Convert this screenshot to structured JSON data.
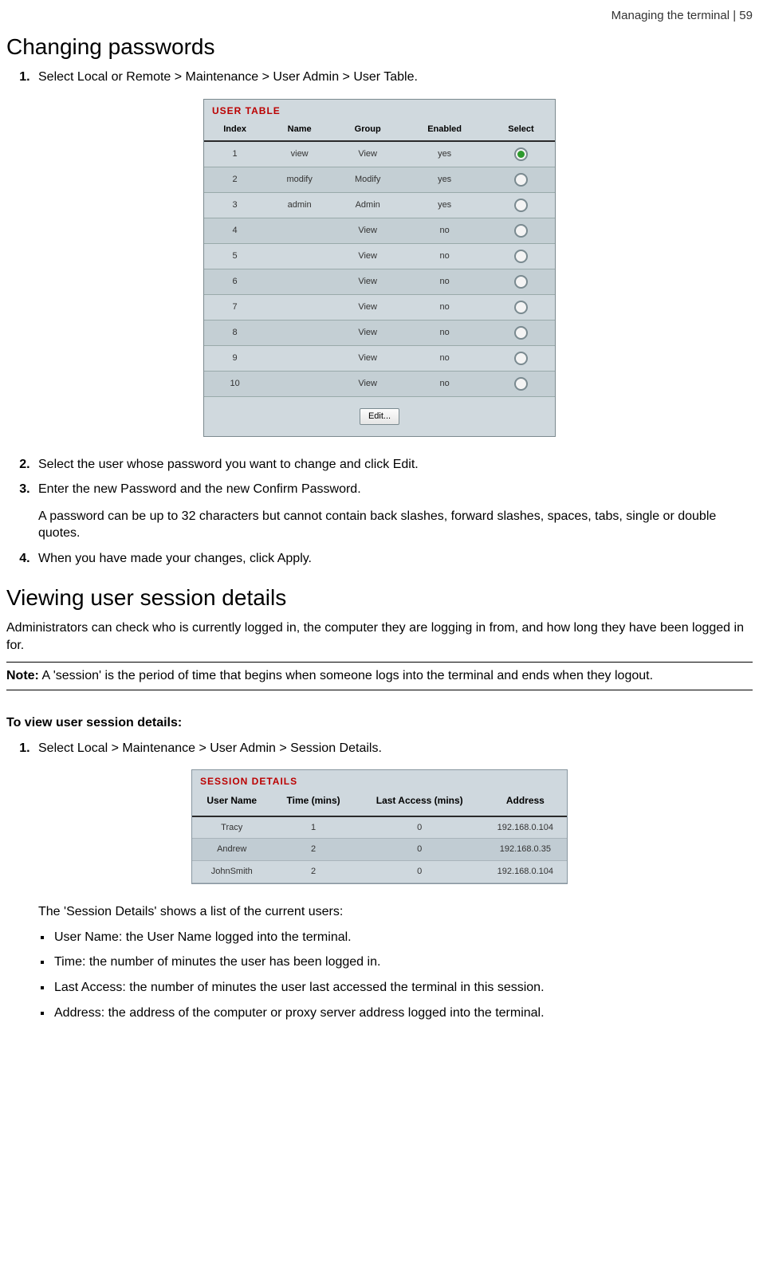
{
  "header": {
    "right": "Managing the terminal  |  59"
  },
  "h1": "Changing passwords",
  "step1": "Select Local or Remote > Maintenance > User Admin > User Table.",
  "userTable": {
    "title": "USER TABLE",
    "cols": {
      "c0": "Index",
      "c1": "Name",
      "c2": "Group",
      "c3": "Enabled",
      "c4": "Select"
    },
    "rows": [
      {
        "idx": "1",
        "name": "view",
        "group": "View",
        "enabled": "yes",
        "selected": true
      },
      {
        "idx": "2",
        "name": "modify",
        "group": "Modify",
        "enabled": "yes",
        "selected": false
      },
      {
        "idx": "3",
        "name": "admin",
        "group": "Admin",
        "enabled": "yes",
        "selected": false
      },
      {
        "idx": "4",
        "name": "",
        "group": "View",
        "enabled": "no",
        "selected": false
      },
      {
        "idx": "5",
        "name": "",
        "group": "View",
        "enabled": "no",
        "selected": false
      },
      {
        "idx": "6",
        "name": "",
        "group": "View",
        "enabled": "no",
        "selected": false
      },
      {
        "idx": "7",
        "name": "",
        "group": "View",
        "enabled": "no",
        "selected": false
      },
      {
        "idx": "8",
        "name": "",
        "group": "View",
        "enabled": "no",
        "selected": false
      },
      {
        "idx": "9",
        "name": "",
        "group": "View",
        "enabled": "no",
        "selected": false
      },
      {
        "idx": "10",
        "name": "",
        "group": "View",
        "enabled": "no",
        "selected": false
      }
    ],
    "editBtn": "Edit..."
  },
  "step2": "Select the user whose password you want to change and click Edit.",
  "step3": "Enter the new Password and the new Confirm Password.",
  "step3_para": "A password can be up to 32 characters but cannot contain back slashes, forward slashes, spaces, tabs, single or double quotes.",
  "step4": "When you have made your changes, click Apply.",
  "h2": "Viewing user session details",
  "intro": "Administrators can check who is currently logged in, the computer they are logging in from, and how long they have been logged in for.",
  "noteLabel": "Note:",
  "noteText": " A 'session' is the period of time that begins when someone logs into the terminal and ends when they logout.",
  "subhead": "To view user session details:",
  "sess_step1": "Select Local > Maintenance > User Admin > Session Details.",
  "sessTable": {
    "title": "SESSION DETAILS",
    "cols": {
      "c0": "User Name",
      "c1": "Time (mins)",
      "c2": "Last Access (mins)",
      "c3": "Address"
    },
    "rows": [
      {
        "user": "Tracy",
        "time": "1",
        "last": "0",
        "addr": "192.168.0.104"
      },
      {
        "user": "Andrew",
        "time": "2",
        "last": "0",
        "addr": "192.168.0.35"
      },
      {
        "user": "JohnSmith",
        "time": "2",
        "last": "0",
        "addr": "192.168.0.104"
      }
    ]
  },
  "desc": "The 'Session Details' shows a list of the current users:",
  "bullets": {
    "b0": "User Name: the User Name logged into the terminal.",
    "b1": "Time: the number of minutes the user has been logged in.",
    "b2": "Last Access: the number of minutes the user last accessed the terminal in this session.",
    "b3": "Address: the address of the computer or proxy server address logged into the terminal."
  }
}
